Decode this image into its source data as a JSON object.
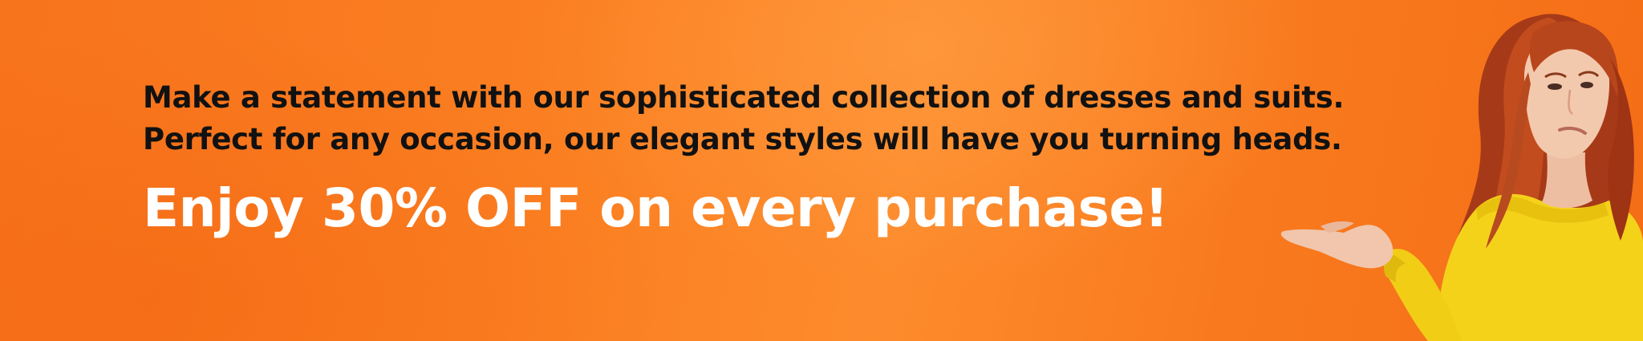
{
  "banner": {
    "tagline_line1": "Make a statement with our sophisticated collection of dresses and suits.",
    "tagline_line2": "Perfect for any occasion, our elegant styles will have you turning heads.",
    "offer": "Enjoy 30% OFF on every purchase!",
    "model_image": "woman-in-yellow-sweater-presenting-hand",
    "colors": {
      "background": "#fb8022",
      "tagline_text": "#111111",
      "offer_text": "#ffffff",
      "sweater": "#f5d31e",
      "hair": "#b3411c"
    }
  }
}
